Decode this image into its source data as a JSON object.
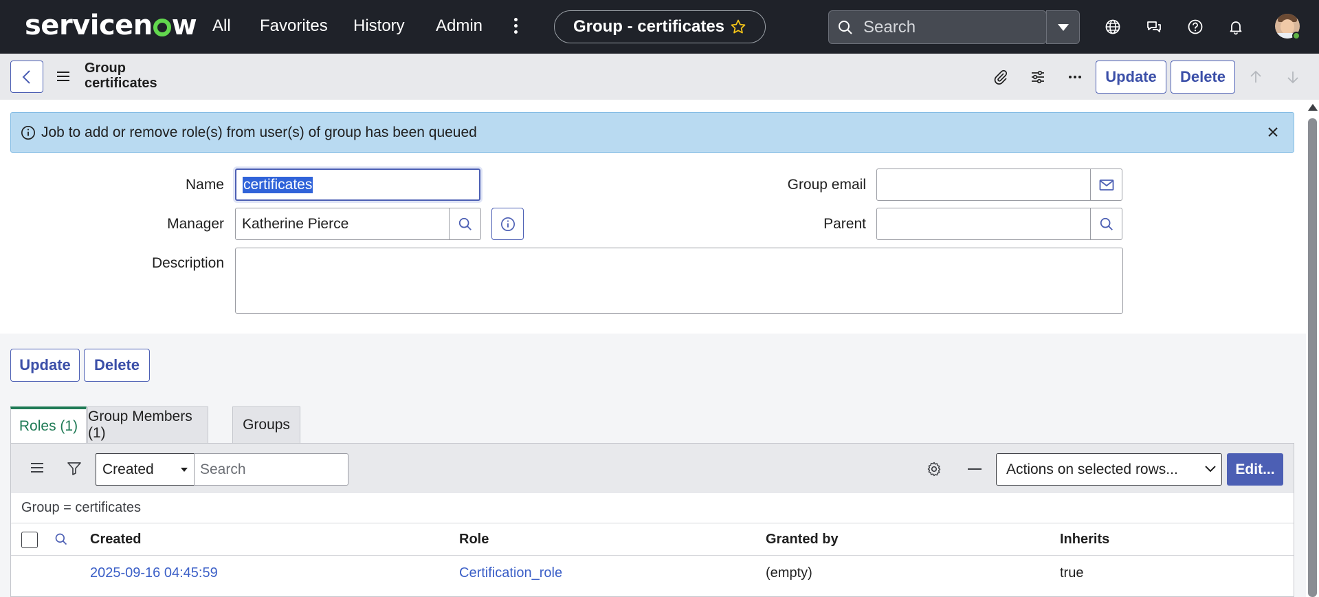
{
  "nav": {
    "logo_pre": "servicen",
    "logo_post": "w",
    "items": [
      "All",
      "Favorites",
      "History",
      "Admin"
    ],
    "context_title": "Group - certificates",
    "search_placeholder": "Search"
  },
  "header": {
    "title_line1": "Group",
    "title_line2": "certificates",
    "update_label": "Update",
    "delete_label": "Delete"
  },
  "alert": {
    "message": "Job to add or remove role(s) from user(s) of group has been queued"
  },
  "form": {
    "name_label": "Name",
    "name_value": "certificates",
    "manager_label": "Manager",
    "manager_value": "Katherine Pierce",
    "description_label": "Description",
    "description_value": "",
    "group_email_label": "Group email",
    "group_email_value": "",
    "parent_label": "Parent",
    "parent_value": ""
  },
  "bottom_buttons": {
    "update_label": "Update",
    "delete_label": "Delete"
  },
  "tabs": [
    {
      "label": "Roles (1)",
      "active": true
    },
    {
      "label": "Group Members (1)",
      "active": false
    },
    {
      "label": "Groups",
      "active": false
    }
  ],
  "list": {
    "filter_field": "Created",
    "search_placeholder": "Search",
    "actions_label": "Actions on selected rows...",
    "edit_label": "Edit...",
    "breadcrumb": "Group = certificates",
    "columns": [
      "Created",
      "Role",
      "Granted by",
      "Inherits"
    ],
    "rows": [
      {
        "created": "2025-09-16 04:45:59",
        "role": "Certification_role",
        "granted_by": "(empty)",
        "inherits": "true"
      }
    ]
  },
  "colors": {
    "accent": "#4c5fb4",
    "nav_bg": "#1f2229",
    "alert_bg": "#b9daf1",
    "active_tab": "#1f7a55",
    "logo_green": "#62d84e"
  }
}
